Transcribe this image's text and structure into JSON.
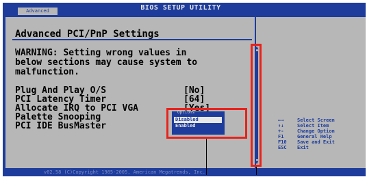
{
  "app": {
    "title": "BIOS SETUP UTILITY",
    "tab": "Advanced"
  },
  "main": {
    "heading": "Advanced PCI/PnP Settings",
    "warning": [
      "WARNING: Setting wrong values in",
      "below sections may cause system to",
      "malfunction."
    ],
    "settings": [
      {
        "label": "Plug And Play O/S",
        "value": "[No]"
      },
      {
        "label": "PCI Latency Timer",
        "value": "[64]"
      },
      {
        "label": "Allocate IRQ to PCI VGA",
        "value": "[Yes]"
      },
      {
        "label": "Palette Snooping",
        "value": ""
      },
      {
        "label": "PCI IDE BusMaster",
        "value": ""
      }
    ]
  },
  "popup": {
    "title": "Options",
    "options": [
      "Disabled",
      "Enabled"
    ],
    "selected": "Disabled"
  },
  "help": [
    {
      "key": "←→",
      "desc": "Select Screen"
    },
    {
      "key": "↑↓",
      "desc": "Select Item"
    },
    {
      "key": "+-",
      "desc": "Change Option"
    },
    {
      "key": "F1",
      "desc": "General Help"
    },
    {
      "key": "F10",
      "desc": "Save and Exit"
    },
    {
      "key": "ESC",
      "desc": "Exit"
    }
  ],
  "footer": "v02.58 (C)Copyright 1985-2005, American Megatrends, Inc.",
  "scrollbar": {
    "up": "▲",
    "down": "▼"
  },
  "colors": {
    "background": "#1d3c9c",
    "panel": "#b7b7b7",
    "highlight": "#e8221a"
  }
}
